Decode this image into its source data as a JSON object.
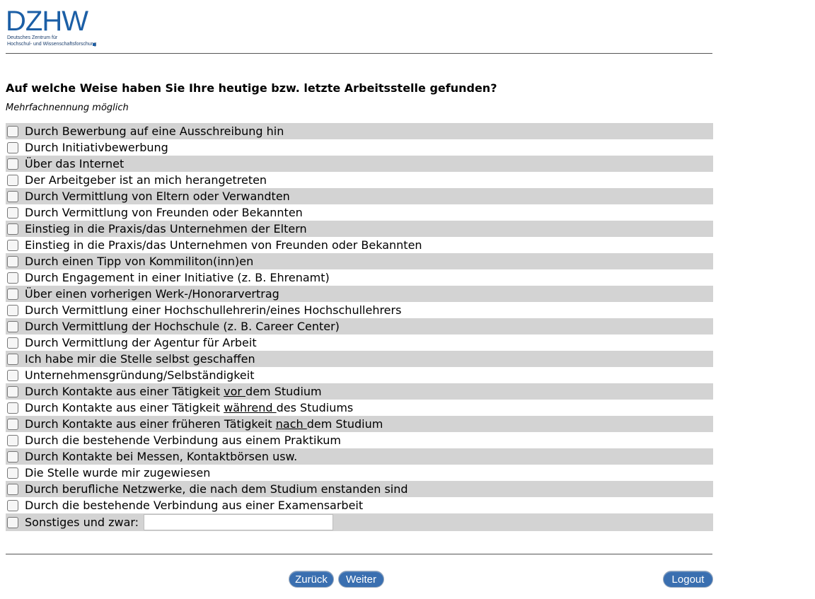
{
  "logo": {
    "text": "DZHW",
    "line1": "Deutsches Zentrum für",
    "line2": "Hochschul- und Wissenschaftsforschung"
  },
  "question": "Auf welche Weise haben Sie Ihre heutige bzw. letzte Arbeitsstelle gefunden?",
  "hint": "Mehrfachnennung möglich",
  "options": [
    {
      "label": "Durch Bewerbung auf eine Ausschreibung hin"
    },
    {
      "label": "Durch Initiativbewerbung"
    },
    {
      "label": "Über das Internet"
    },
    {
      "label": "Der Arbeitgeber ist an mich herangetreten"
    },
    {
      "label": "Durch Vermittlung von Eltern oder Verwandten"
    },
    {
      "label": "Durch Vermittlung von Freunden oder Bekannten"
    },
    {
      "label": "Einstieg in die Praxis/das Unternehmen der Eltern"
    },
    {
      "label": "Einstieg in die Praxis/das Unternehmen von Freunden oder Bekannten"
    },
    {
      "label": "Durch einen Tipp von Kommiliton(inn)en"
    },
    {
      "label": "Durch Engagement in einer Initiative (z. B. Ehrenamt)"
    },
    {
      "label": "Über einen vorherigen Werk-/Honorarvertrag"
    },
    {
      "label": "Durch Vermittlung einer Hochschullehrerin/eines Hochschullehrers"
    },
    {
      "label": "Durch Vermittlung der Hochschule (z. B. Career Center)"
    },
    {
      "label": "Durch Vermittlung der Agentur für Arbeit"
    },
    {
      "label": "Ich habe mir die Stelle selbst geschaffen"
    },
    {
      "label": "Unternehmensgründung/Selbständigkeit"
    },
    {
      "pre": "Durch Kontakte aus einer Tätigkeit ",
      "em": "vor ",
      "post": "dem Studium"
    },
    {
      "pre": "Durch Kontakte aus einer Tätigkeit ",
      "em": "während ",
      "post": "des Studiums"
    },
    {
      "pre": "Durch Kontakte aus einer früheren Tätigkeit ",
      "em": "nach ",
      "post": "dem Studium"
    },
    {
      "label": "Durch die bestehende Verbindung aus einem Praktikum"
    },
    {
      "label": "Durch Kontakte bei Messen, Kontaktbörsen usw."
    },
    {
      "label": "Die Stelle wurde mir zugewiesen"
    },
    {
      "label": "Durch berufliche Netzwerke, die nach dem Studium enstanden sind"
    },
    {
      "label": "Durch die bestehende Verbindung aus einer Examensarbeit"
    }
  ],
  "other": {
    "label": "Sonstiges und zwar:",
    "value": ""
  },
  "buttons": {
    "back": "Zurück",
    "next": "Weiter",
    "logout": "Logout"
  }
}
